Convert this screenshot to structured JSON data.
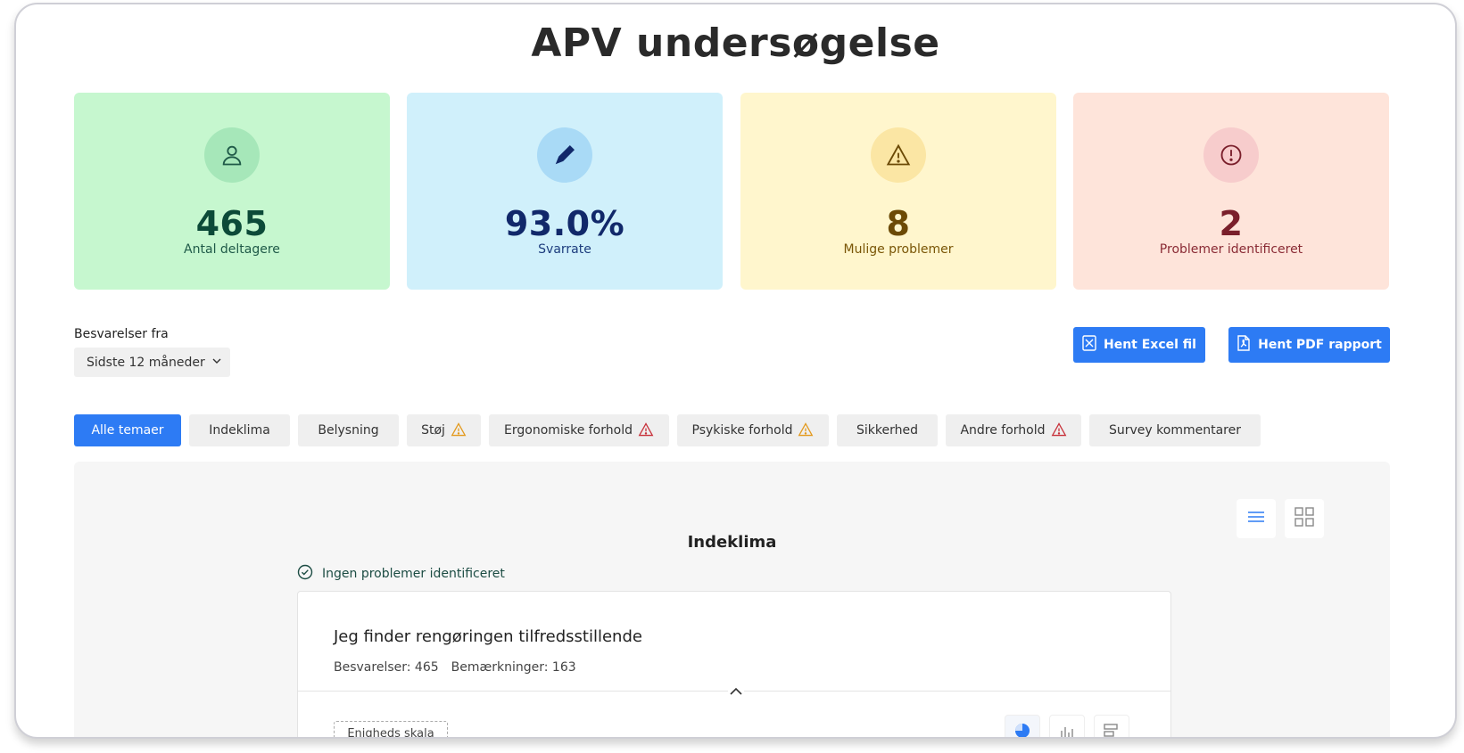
{
  "title": "APV undersøgelse",
  "stats": [
    {
      "value": "465",
      "label": "Antal deltagere",
      "icon": "user-icon"
    },
    {
      "value": "93.0%",
      "label": "Svarrate",
      "icon": "pencil-icon"
    },
    {
      "value": "8",
      "label": "Mulige problemer",
      "icon": "warning-icon"
    },
    {
      "value": "2",
      "label": "Problemer identificeret",
      "icon": "alert-circle-icon"
    }
  ],
  "filter": {
    "label": "Besvarelser fra",
    "selected": "Sidste 12 måneder"
  },
  "downloads": {
    "excel_label": "Hent Excel fil",
    "pdf_label": "Hent PDF rapport"
  },
  "tabs": [
    {
      "label": "Alle temaer",
      "active": true,
      "warning": "none"
    },
    {
      "label": "Indeklima",
      "active": false,
      "warning": "none"
    },
    {
      "label": "Belysning",
      "active": false,
      "warning": "none"
    },
    {
      "label": "Støj",
      "active": false,
      "warning": "orange"
    },
    {
      "label": "Ergonomiske forhold",
      "active": false,
      "warning": "red"
    },
    {
      "label": "Psykiske forhold",
      "active": false,
      "warning": "orange"
    },
    {
      "label": "Sikkerhed",
      "active": false,
      "warning": "none"
    },
    {
      "label": "Andre forhold",
      "active": false,
      "warning": "red"
    },
    {
      "label": "Survey kommentarer",
      "active": false,
      "warning": "none"
    }
  ],
  "section": {
    "title": "Indeklima",
    "status": "Ingen problemer identificeret"
  },
  "question": {
    "title": "Jeg finder rengøringen tilfredsstillende",
    "responses": "Besvarelser: 465",
    "remarks": "Bemærkninger: 163",
    "scale_label": "Enigheds skala"
  },
  "colors": {
    "accent": "#2d7bf4",
    "warning_orange": "#e39a1f",
    "warning_red": "#c8323b"
  }
}
